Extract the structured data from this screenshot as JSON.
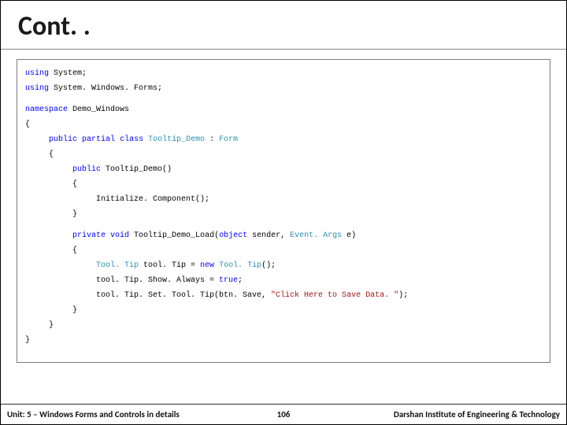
{
  "title": "Cont. .",
  "code": {
    "l1a": "using",
    "l1b": " System;",
    "l2a": "using",
    "l2b": " System. Windows. Forms;",
    "l3a": "namespace",
    "l3b": " Demo_Windows",
    "l4": "{",
    "l5a": "public",
    "l5b": "partial",
    "l5c": "class",
    "l5d": "Tooltip_Demo",
    "l5e": " : ",
    "l5f": "Form",
    "l6": "{",
    "l7a": "public",
    "l7b": " Tooltip_Demo()",
    "l8": "{",
    "l9": "Initialize. Component();",
    "l10": "}",
    "l11a": "private",
    "l11b": "void",
    "l11c": " Tooltip_Demo_Load(",
    "l11d": "object",
    "l11e": " sender, ",
    "l11f": "Event. Args",
    "l11g": " e)",
    "l12": "{",
    "l13a": "Tool. Tip",
    "l13b": " tool. Tip = ",
    "l13c": "new",
    "l13d": "Tool. Tip",
    "l13e": "();",
    "l14a": "tool. Tip. Show. Always = ",
    "l14b": "true",
    "l14c": ";",
    "l15a": "tool. Tip. Set. Tool. Tip(btn. Save, ",
    "l15b": "\"Click Here to Save Data. \"",
    "l15c": ");",
    "l16": "}",
    "l17": "}",
    "l18": "}"
  },
  "footer": {
    "left": "Unit: 5 – Windows Forms and Controls in details",
    "mid": "106",
    "right": "Darshan Institute of Engineering & Technology"
  }
}
